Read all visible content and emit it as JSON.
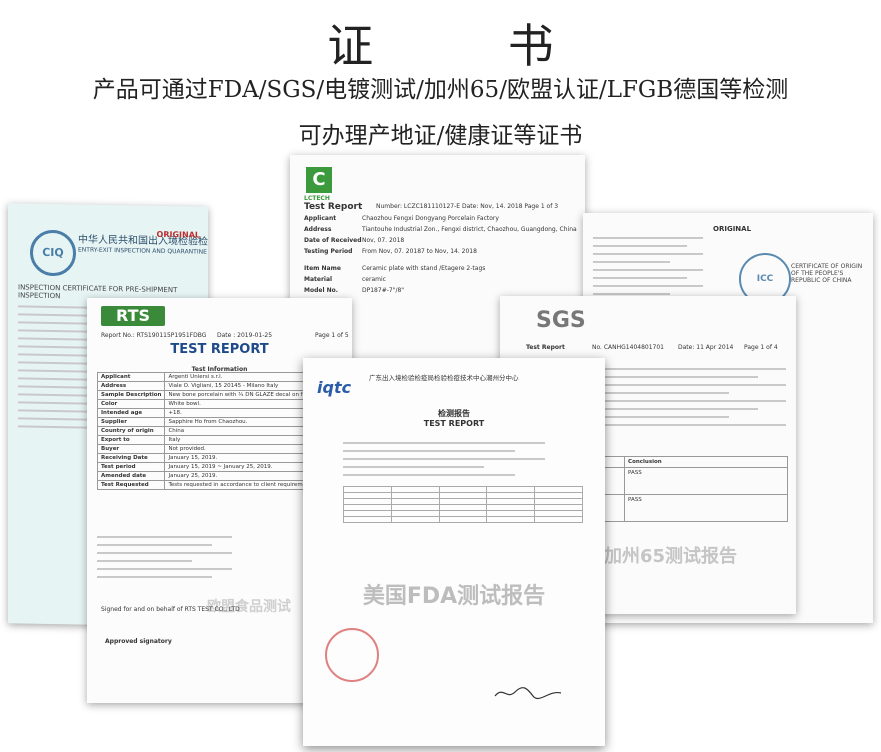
{
  "header": {
    "title": "证   书",
    "subtitle1": "产品可通过FDA/SGS/电镀测试/加州65/欧盟认证/LFGB德国等检测",
    "subtitle2": "可办理产地证/健康证等证书"
  },
  "ciq": {
    "logo": "CIQ",
    "title_cn": "中华人民共和国出入境检验检疫",
    "title_en": "ENTRY-EXIT INSPECTION AND QUARANTINE OF THE PEOPLE'S REPUBLIC OF CHINA",
    "original": "ORIGINAL",
    "cert_title": "INSPECTION CERTIFICATE FOR PRE-SHIPMENT INSPECTION"
  },
  "lctech": {
    "logo": "C",
    "brand": "LCTECH",
    "report_label": "Test Report",
    "number": "Number: LCZC181110127-E    Date: Nov, 14. 2018    Page 1 of 3",
    "rows": [
      {
        "k": "Applicant",
        "v": "Chaozhou Fengxi Dongyang Porcelain Factory"
      },
      {
        "k": "Address",
        "v": "Tiantouhe Industrial Zon., Fengxi district, Chaozhou, Guangdong, China"
      },
      {
        "k": "Date of Received",
        "v": "Nov, 07. 2018"
      },
      {
        "k": "Testing Period",
        "v": "From Nov, 07. 20187 to Nov, 14. 2018"
      },
      {
        "k": "Item Name",
        "v": "Ceramic plate with stand /Etagere 2-tags"
      },
      {
        "k": "Material",
        "v": "ceramic"
      },
      {
        "k": "Model No.",
        "v": "DP187#-7\"/8\""
      }
    ]
  },
  "icc": {
    "original": "ORIGINAL",
    "seal": "ICC",
    "cert": "CERTIFICATE OF ORIGIN OF THE PEOPLE'S REPUBLIC OF CHINA"
  },
  "rts": {
    "logo": "RTS",
    "report_no": "Report No.: RTS190115P1951FDBG",
    "date": "Date : 2019-01-25",
    "page": "Page 1 of 5",
    "title": "TEST REPORT",
    "info_heading": "Test Information",
    "rows": [
      {
        "k": "Applicant",
        "v": "Argenti Uniersi s.r.l."
      },
      {
        "k": "Address",
        "v": "Viale O. Vigliani, 15 20145 - Milano Italy"
      },
      {
        "k": "Sample Description",
        "v": "New bone porcelain with ¾ DN GLAZE decal on front and on bottom."
      },
      {
        "k": "Color",
        "v": "White bowl."
      },
      {
        "k": "Intended age",
        "v": "+18."
      },
      {
        "k": "Supplier",
        "v": "Sapphire Ho from Chaozhou."
      },
      {
        "k": "Country of origin",
        "v": "China"
      },
      {
        "k": "Export to",
        "v": "Italy"
      },
      {
        "k": "Buyer",
        "v": "Not provided."
      },
      {
        "k": "Receiving Date",
        "v": "January 15, 2019."
      },
      {
        "k": "Test period",
        "v": "January 15, 2019 ~ January 25, 2019."
      },
      {
        "k": "Amended date",
        "v": "January 25, 2019."
      },
      {
        "k": "Test Requested",
        "v": "Tests requested in accordance to client requirement."
      }
    ],
    "watermark": "欧盟食品测试",
    "signed": "Signed for and on behalf of RTS TEST CO., LTD",
    "approve": "Approved signatory"
  },
  "sgs": {
    "logo": "SGS",
    "report_label": "Test Report",
    "no": "No. CANHG1404801701",
    "date": "Date: 11 Apr 2014",
    "page": "Page 1 of 4",
    "conclusion_label": "Conclusion",
    "conclusion1": "PASS",
    "conclusion2": "PASS",
    "watermark": "加州65测试报告"
  },
  "iqtc": {
    "logo": "iqtc",
    "title_cn": "广东出入境检验检疫局检验检疫技术中心潮州分中心",
    "report_cn": "检测报告",
    "report_en": "TEST REPORT",
    "watermark": "美国FDA测试报告"
  }
}
